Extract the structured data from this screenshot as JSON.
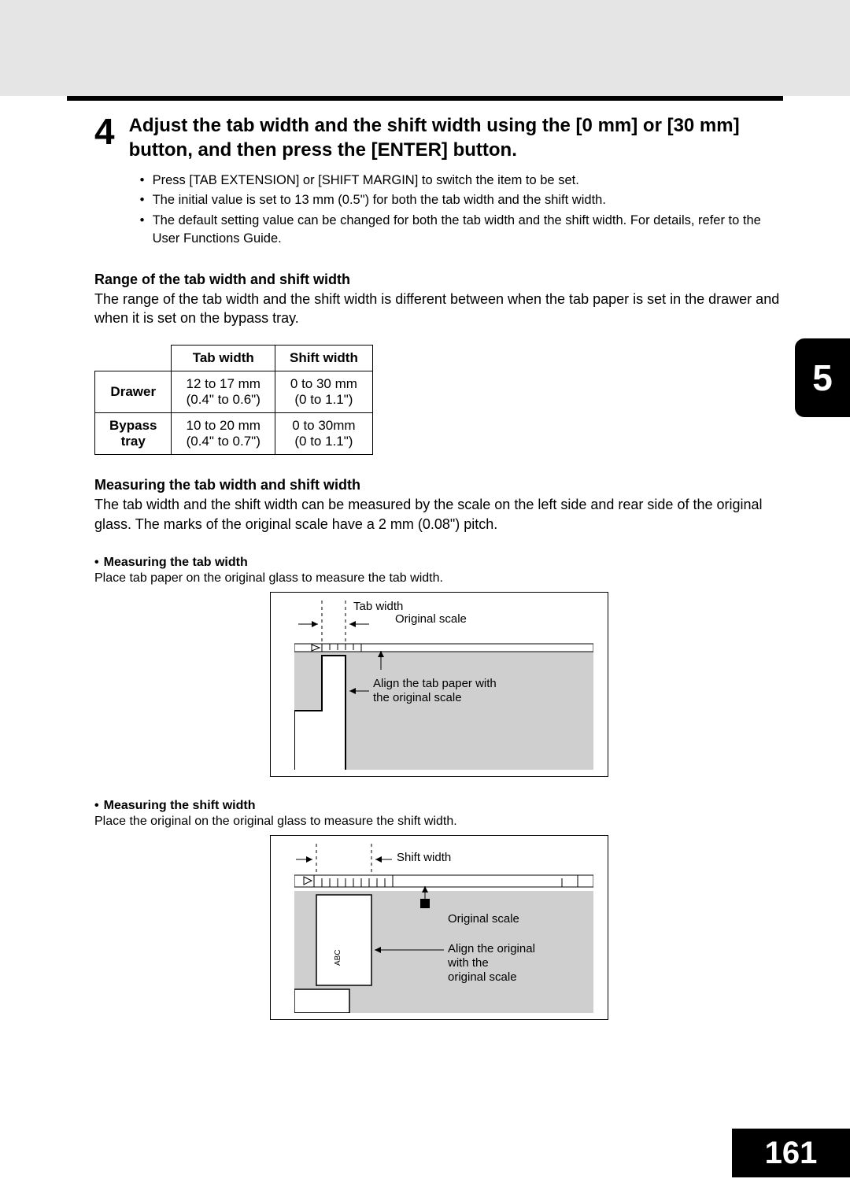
{
  "step": {
    "number": "4",
    "title": "Adjust the tab width and the shift width using the [0 mm] or [30 mm] button, and then press the [ENTER] button.",
    "notes": [
      "Press [TAB EXTENSION] or [SHIFT MARGIN] to switch the item to be set.",
      "The initial value is set to 13 mm (0.5\") for both the tab width and the shift width.",
      "The default setting value can be changed for both the tab width and the shift width. For details, refer to the User Functions Guide."
    ]
  },
  "range": {
    "heading": "Range of the tab width and shift width",
    "text": "The range of the tab width and the shift width is different between when the tab paper is set in the drawer and when it is set on the bypass tray.",
    "table": {
      "col1": "Tab width",
      "col2": "Shift width",
      "rows": [
        {
          "label": "Drawer",
          "tab_mm": "12 to 17 mm",
          "tab_in": "(0.4\" to 0.6\")",
          "shift_mm": "0 to 30 mm",
          "shift_in": "(0 to 1.1\")"
        },
        {
          "label": "Bypass tray",
          "tab_mm": "10 to 20 mm",
          "tab_in": "(0.4\" to 0.7\")",
          "shift_mm": "0 to 30mm",
          "shift_in": "(0 to 1.1\")"
        }
      ]
    }
  },
  "measure": {
    "heading": "Measuring the tab width and shift width",
    "text": "The tab width and the shift width can be measured by the scale on the left side and rear side of the original glass. The marks of the original scale have a 2 mm (0.08\") pitch.",
    "tab": {
      "heading": "Measuring the tab width",
      "text": "Place tab paper on the original glass to measure the tab width.",
      "labels": {
        "tab_width": "Tab width",
        "original_scale": "Original scale",
        "align1": "Align the tab paper with",
        "align2": "the original scale"
      }
    },
    "shift": {
      "heading": "Measuring the shift width",
      "text": "Place the original on the original glass to measure the shift width.",
      "labels": {
        "shift_width": "Shift width",
        "original_scale": "Original scale",
        "align1": "Align the original",
        "align2": "with the",
        "align3": "original scale",
        "abc": "ABC"
      }
    }
  },
  "chapter_tab": "5",
  "page_number": "161"
}
